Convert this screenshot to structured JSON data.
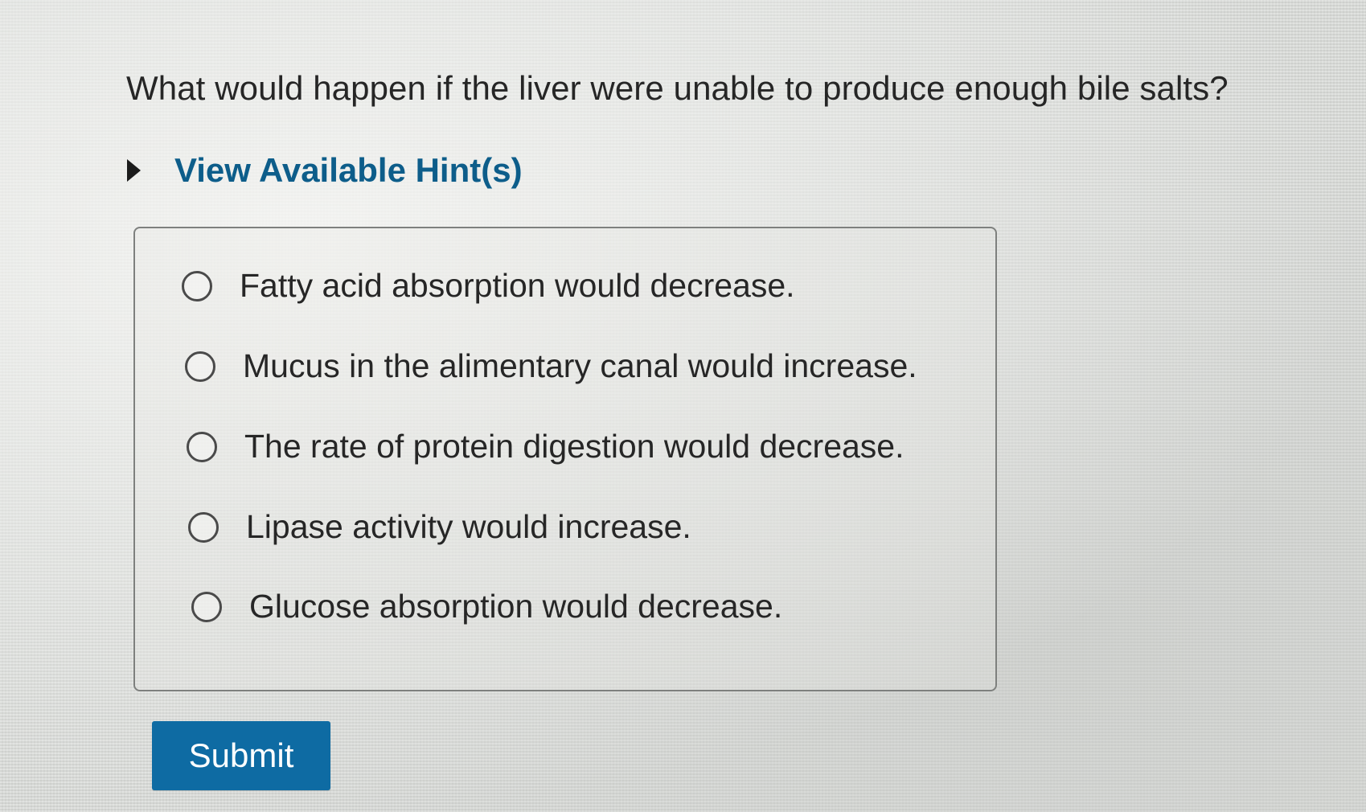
{
  "question": {
    "text": "What would happen if the liver were unable to produce enough bile salts?"
  },
  "hints": {
    "label": "View Available Hint(s)",
    "icon": "caret-right-icon"
  },
  "options": [
    {
      "label": "Fatty acid absorption would decrease.",
      "selected": false
    },
    {
      "label": "Mucus in the alimentary canal would increase.",
      "selected": false
    },
    {
      "label": "The rate of protein digestion would decrease.",
      "selected": false
    },
    {
      "label": "Lipase activity would increase.",
      "selected": false
    },
    {
      "label": "Glucose absorption would decrease.",
      "selected": false
    }
  ],
  "submit": {
    "label": "Submit"
  },
  "colors": {
    "accent": "#0e6ba3",
    "hint_link": "#0d5d8a",
    "text": "#262626"
  }
}
